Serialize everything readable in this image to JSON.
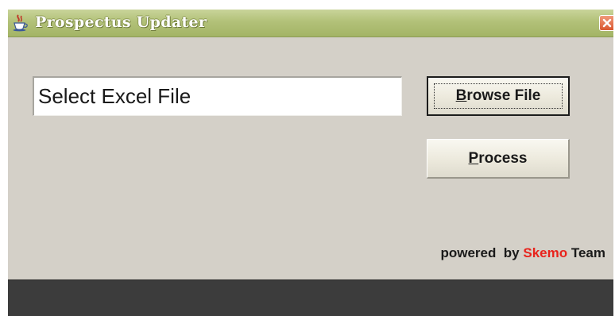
{
  "window": {
    "title": "Prospectus Updater",
    "icon": "java-cup-icon",
    "close_icon": "close-icon"
  },
  "form": {
    "file_value": "Select Excel File",
    "browse": {
      "mnemonic": "B",
      "rest": "rowse File"
    },
    "process": {
      "mnemonic": "P",
      "rest": "rocess"
    }
  },
  "footer": {
    "prefix": "powered  by ",
    "brand": "Skemo",
    "suffix": " Team"
  },
  "colors": {
    "titlebar": "#b2c178",
    "window_bg": "#d4d0c8",
    "brand": "#e8231c",
    "bottom_bar": "#3c3c3c"
  }
}
